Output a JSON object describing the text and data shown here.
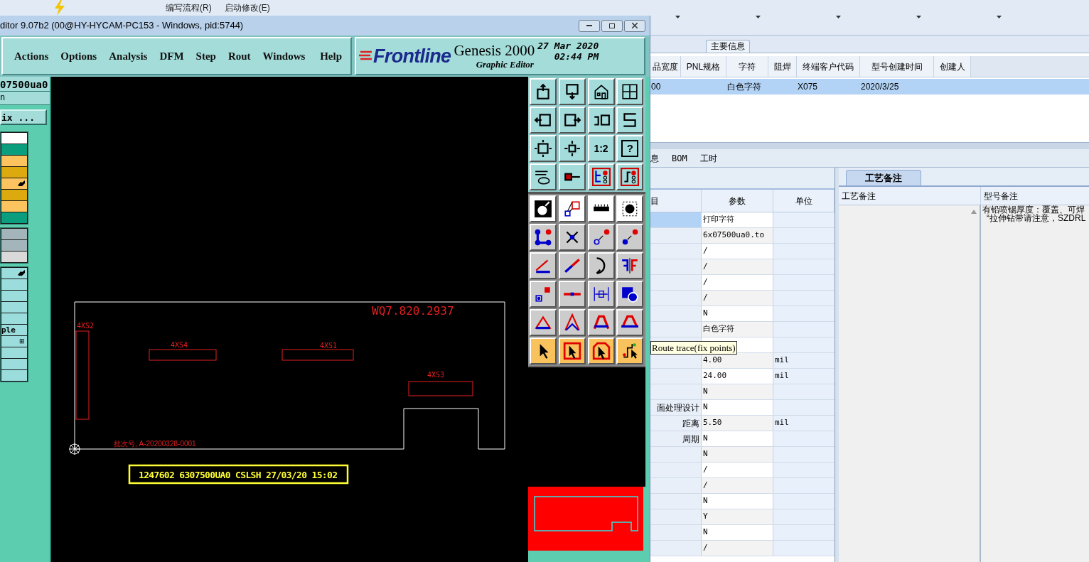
{
  "background_app": {
    "ribbon": {
      "items": [
        "编写流程(R)",
        "启动修改(E)"
      ]
    },
    "section_tab": "主要信息",
    "main_table": {
      "columns": [
        "品宽度",
        "PNL规格",
        "字符",
        "阻焊",
        "终端客户代码",
        "型号创建时间",
        "创建人"
      ],
      "rows": [
        {
          "selected": true,
          "cells": [
            "00",
            "",
            "白色字符",
            "",
            "X075",
            "2020/3/25",
            ""
          ]
        }
      ]
    },
    "detail_tabs": [
      "息",
      "BOM",
      "工时"
    ],
    "params_table": {
      "columns": [
        "目",
        "参数",
        "单位"
      ],
      "rows": [
        {
          "selected": true,
          "value": "打印字符"
        },
        {
          "selected": false,
          "value": "6x07500ua0.to"
        },
        {
          "selected": false,
          "value": "/"
        },
        {
          "selected": false,
          "value": "/"
        },
        {
          "selected": false,
          "value": "/"
        },
        {
          "selected": false,
          "value": "/"
        },
        {
          "selected": false,
          "value": "N"
        },
        {
          "selected": false,
          "value": "白色字符"
        },
        {
          "selected": false
        },
        {
          "selected": false,
          "value": "4.00",
          "unit": "mil"
        },
        {
          "selected": false,
          "value": "24.00",
          "unit": "mil"
        },
        {
          "selected": false,
          "value": "N"
        },
        {
          "selected": false,
          "label": "面处理设计",
          "value": "N"
        },
        {
          "selected": false,
          "label": "距离",
          "value": "5.50",
          "unit": "mil"
        },
        {
          "selected": false,
          "label": "周期",
          "value": "N"
        },
        {
          "selected": false,
          "value": "N"
        },
        {
          "selected": false,
          "value": "/"
        },
        {
          "selected": false,
          "value": "/"
        },
        {
          "selected": false,
          "value": "N"
        },
        {
          "selected": false,
          "value": "Y"
        },
        {
          "selected": false,
          "value": "N"
        },
        {
          "selected": false,
          "value": "/"
        }
      ]
    },
    "notes_panel": {
      "tab": "工艺备注",
      "columns": [
        "工艺备注",
        "型号备注"
      ],
      "lines": [
        "有铅喷锡厚度：覆盖、可焊",
        "“拉伸钻带请注意，SZDRL"
      ]
    }
  },
  "editor": {
    "title": "ditor 9.07b2 (00@HY-HYCAM-PC153 - Windows, pid:5744)",
    "menu": [
      "Actions",
      "Options",
      "Analysis",
      "DFM",
      "Step",
      "Rout",
      "Windows",
      "Help"
    ],
    "logo": {
      "brand": "Frontline",
      "product": "Genesis 2000",
      "subtitle": "Graphic Editor",
      "date": "27 Mar 2020",
      "time": "02:44 PM"
    },
    "job": "07500ua0",
    "step": "n",
    "matrix_button": "ix ...",
    "layer_groups": [
      {
        "layers": [
          {
            "color": "#ffffff",
            "pointer": false
          },
          {
            "color": "#0a9e7e",
            "pointer": false
          },
          {
            "color": "#fcc35e",
            "pointer": false
          },
          {
            "color": "#dcaa0e",
            "pointer": false
          },
          {
            "color": "#fcc35e",
            "pointer": true
          },
          {
            "color": "#dcaa0e",
            "pointer": false
          },
          {
            "color": "#fcc35e",
            "pointer": false
          },
          {
            "color": "#0a9e7e",
            "pointer": false
          }
        ]
      },
      {
        "layers": [
          {
            "color": "#a3b5bb",
            "pointer": false
          },
          {
            "color": "#a3b5bb",
            "pointer": false
          },
          {
            "color": "#d9d9d9",
            "pointer": false
          }
        ]
      },
      {
        "layers": [
          {
            "color": "#9bdcdc",
            "pointer": true
          },
          {
            "color": "#9bdcdc",
            "pointer": false
          },
          {
            "color": "#9bdcdc",
            "pointer": false
          },
          {
            "color": "#9bdcdc",
            "pointer": false
          },
          {
            "color": "#9bdcdc",
            "pointer": false
          },
          {
            "color": "#9bdcdc",
            "pointer": false,
            "text": "ple"
          },
          {
            "color": "#9bdcdc",
            "pointer": false,
            "mark": "⊞"
          },
          {
            "color": "#9bdcdc",
            "pointer": false
          },
          {
            "color": "#9bdcdc",
            "pointer": false
          },
          {
            "color": "#9bdcdc",
            "pointer": false
          }
        ]
      }
    ],
    "canvas": {
      "profile_label": "WQ7.820.2937",
      "components": [
        {
          "ref": "4XS2"
        },
        {
          "ref": "4XS4"
        },
        {
          "ref": "4XS1"
        },
        {
          "ref": "4XS3"
        }
      ],
      "batch_text": "批次号, A-20200328-0001",
      "marking_text": "1247602 6307500UA0 CSLSH 27/03/20 15:02"
    },
    "toolbar": {
      "ratio_label": "1:2",
      "help_label": "?"
    }
  },
  "tooltip": "Route trace(fix points)"
}
